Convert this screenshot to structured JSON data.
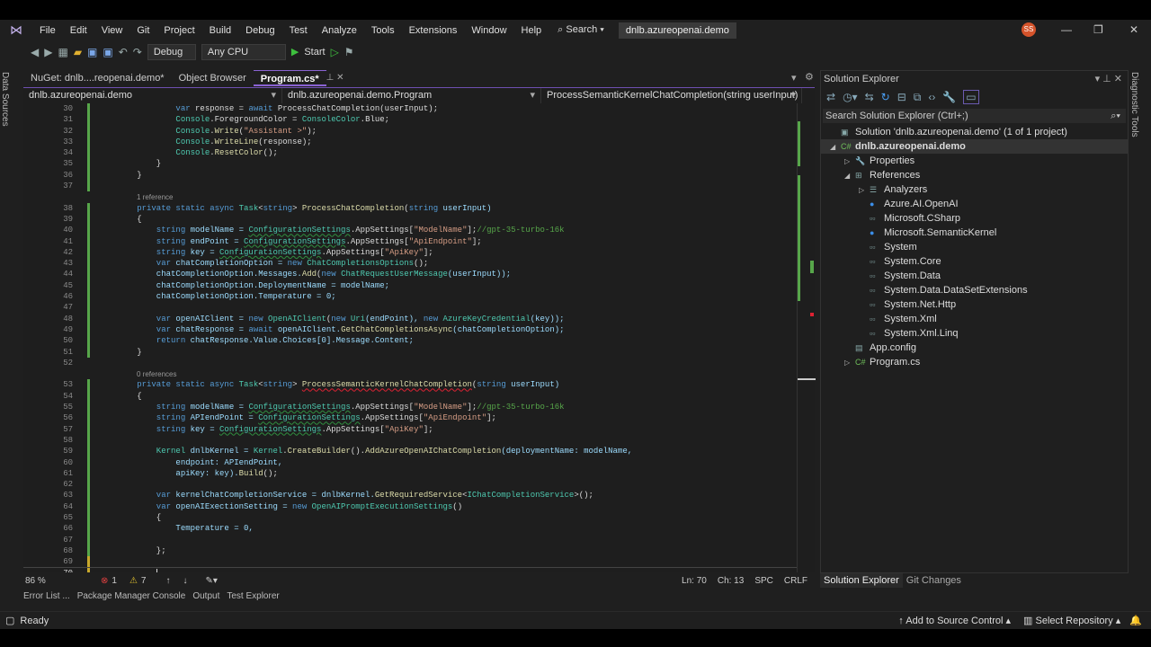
{
  "menu": [
    "File",
    "Edit",
    "View",
    "Git",
    "Project",
    "Build",
    "Debug",
    "Test",
    "Analyze",
    "Tools",
    "Extensions",
    "Window",
    "Help"
  ],
  "search_label": "Search",
  "window_title": "dnlb.azureopenai.demo",
  "avatar": "SS",
  "toolbar": {
    "config": "Debug",
    "platform": "Any CPU",
    "start": "Start"
  },
  "left_strip": "Data Sources",
  "right_strip": "Diagnostic Tools",
  "tabs": [
    {
      "label": "NuGet: dnlb....reopenai.demo*"
    },
    {
      "label": "Object Browser"
    },
    {
      "label": "Program.cs*"
    }
  ],
  "nav": {
    "project": "dnlb.azureopenai.demo",
    "type": "dnlb.azureopenai.demo.Program",
    "member": "ProcessSemanticKernelChatCompletion(string userInput)"
  },
  "code": [
    {
      "n": "30",
      "t": [
        [
          "                var ",
          "kw"
        ],
        [
          "response = ",
          "id"
        ],
        [
          "await ",
          "kw"
        ],
        [
          "ProcessChatCompletion(userInput);",
          "id"
        ]
      ]
    },
    {
      "n": "31",
      "t": [
        [
          "                Console",
          "ty"
        ],
        [
          ".ForegroundColor = ",
          "id"
        ],
        [
          "ConsoleColor",
          "ty"
        ],
        [
          ".Blue;",
          "id"
        ]
      ]
    },
    {
      "n": "32",
      "t": [
        [
          "                Console",
          "ty"
        ],
        [
          ".",
          "id"
        ],
        [
          "Write",
          "mt"
        ],
        [
          "(",
          "id"
        ],
        [
          "\"Assistant >\"",
          "st"
        ],
        [
          ");",
          "id"
        ]
      ]
    },
    {
      "n": "33",
      "t": [
        [
          "                Console",
          "ty"
        ],
        [
          ".",
          "id"
        ],
        [
          "WriteLine",
          "mt"
        ],
        [
          "(response);",
          "id"
        ]
      ]
    },
    {
      "n": "34",
      "t": [
        [
          "                Console",
          "ty"
        ],
        [
          ".",
          "id"
        ],
        [
          "ResetColor",
          "mt"
        ],
        [
          "();",
          "id"
        ]
      ]
    },
    {
      "n": "35",
      "t": [
        [
          "            }",
          "id"
        ]
      ]
    },
    {
      "n": "36",
      "t": [
        [
          "        }",
          "id"
        ]
      ]
    },
    {
      "n": "37",
      "t": []
    },
    {
      "n": "38",
      "lens": "1 reference",
      "t": [
        [
          "        private static async ",
          "kw"
        ],
        [
          "Task",
          "ty"
        ],
        [
          "<",
          "id"
        ],
        [
          "string",
          "kw"
        ],
        [
          "> ",
          "id"
        ],
        [
          "ProcessChatCompletion",
          "mt"
        ],
        [
          "(",
          "id"
        ],
        [
          "string ",
          "kw"
        ],
        [
          "userInput)",
          "vr"
        ]
      ]
    },
    {
      "n": "39",
      "t": [
        [
          "        {",
          "id"
        ]
      ]
    },
    {
      "n": "40",
      "t": [
        [
          "            string ",
          "kw"
        ],
        [
          "modelName = ",
          "vr"
        ],
        [
          "ConfigurationSettings",
          "ty sq"
        ],
        [
          ".AppSettings[",
          "id"
        ],
        [
          "\"ModelName\"",
          "st"
        ],
        [
          "];",
          "id"
        ],
        [
          "//gpt-35-turbo-16k",
          "cm"
        ]
      ]
    },
    {
      "n": "41",
      "t": [
        [
          "            string ",
          "kw"
        ],
        [
          "endPoint = ",
          "vr"
        ],
        [
          "ConfigurationSettings",
          "ty sq"
        ],
        [
          ".AppSettings[",
          "id"
        ],
        [
          "\"ApiEndpoint\"",
          "st"
        ],
        [
          "];",
          "id"
        ]
      ]
    },
    {
      "n": "42",
      "t": [
        [
          "            string ",
          "kw"
        ],
        [
          "key = ",
          "vr"
        ],
        [
          "ConfigurationSettings",
          "ty sq"
        ],
        [
          ".AppSettings[",
          "id"
        ],
        [
          "\"ApiKey\"",
          "st"
        ],
        [
          "];",
          "id"
        ]
      ]
    },
    {
      "n": "43",
      "t": [
        [
          "            var ",
          "kw"
        ],
        [
          "chatCompletionOption = ",
          "vr"
        ],
        [
          "new ",
          "kw"
        ],
        [
          "ChatCompletionsOptions",
          "ty"
        ],
        [
          "();",
          "id"
        ]
      ]
    },
    {
      "n": "44",
      "t": [
        [
          "            chatCompletionOption.Messages.",
          "vr"
        ],
        [
          "Add",
          "mt"
        ],
        [
          "(",
          "id"
        ],
        [
          "new ",
          "kw"
        ],
        [
          "ChatRequestUserMessage",
          "ty"
        ],
        [
          "(userInput));",
          "vr"
        ]
      ]
    },
    {
      "n": "45",
      "t": [
        [
          "            chatCompletionOption.DeploymentName = modelName;",
          "vr"
        ]
      ]
    },
    {
      "n": "46",
      "t": [
        [
          "            chatCompletionOption.Temperature = 0;",
          "vr"
        ]
      ]
    },
    {
      "n": "47",
      "t": []
    },
    {
      "n": "48",
      "t": [
        [
          "            var ",
          "kw"
        ],
        [
          "openAIClient = ",
          "vr"
        ],
        [
          "new ",
          "kw"
        ],
        [
          "OpenAIClient",
          "ty"
        ],
        [
          "(",
          "id"
        ],
        [
          "new ",
          "kw"
        ],
        [
          "Uri",
          "ty"
        ],
        [
          "(endPoint), ",
          "vr"
        ],
        [
          "new ",
          "kw"
        ],
        [
          "AzureKeyCredential",
          "ty"
        ],
        [
          "(key));",
          "vr"
        ]
      ]
    },
    {
      "n": "49",
      "t": [
        [
          "            var ",
          "kw"
        ],
        [
          "chatResponse = ",
          "vr"
        ],
        [
          "await ",
          "kw"
        ],
        [
          "openAIClient.",
          "vr"
        ],
        [
          "GetChatCompletionsAsync",
          "mt"
        ],
        [
          "(chatCompletionOption);",
          "vr"
        ]
      ]
    },
    {
      "n": "50",
      "t": [
        [
          "            return ",
          "kw"
        ],
        [
          "chatResponse.Value.Choices[0].Message.Content;",
          "vr"
        ]
      ]
    },
    {
      "n": "51",
      "t": [
        [
          "        }",
          "id"
        ]
      ]
    },
    {
      "n": "52",
      "t": []
    },
    {
      "n": "53",
      "lens": "0 references",
      "t": [
        [
          "        private static async ",
          "kw"
        ],
        [
          "Task",
          "ty"
        ],
        [
          "<",
          "id"
        ],
        [
          "string",
          "kw"
        ],
        [
          "> ",
          "id"
        ],
        [
          "ProcessSemanticKernelChatCompletion",
          "mt er"
        ],
        [
          "(",
          "id"
        ],
        [
          "string ",
          "kw"
        ],
        [
          "userInput)",
          "vr"
        ]
      ]
    },
    {
      "n": "54",
      "t": [
        [
          "        {",
          "id"
        ]
      ]
    },
    {
      "n": "55",
      "t": [
        [
          "            string ",
          "kw"
        ],
        [
          "modelName = ",
          "vr"
        ],
        [
          "ConfigurationSettings",
          "ty sq"
        ],
        [
          ".AppSettings[",
          "id"
        ],
        [
          "\"ModelName\"",
          "st"
        ],
        [
          "];",
          "id"
        ],
        [
          "//gpt-35-turbo-16k",
          "cm"
        ]
      ]
    },
    {
      "n": "56",
      "t": [
        [
          "            string ",
          "kw"
        ],
        [
          "APIendPoint = ",
          "vr"
        ],
        [
          "ConfigurationSettings",
          "ty sq"
        ],
        [
          ".AppSettings[",
          "id"
        ],
        [
          "\"ApiEndpoint\"",
          "st"
        ],
        [
          "];",
          "id"
        ]
      ]
    },
    {
      "n": "57",
      "t": [
        [
          "            string ",
          "kw"
        ],
        [
          "key = ",
          "vr"
        ],
        [
          "ConfigurationSettings",
          "ty sq"
        ],
        [
          ".AppSettings[",
          "id"
        ],
        [
          "\"ApiKey\"",
          "st"
        ],
        [
          "];",
          "id"
        ]
      ]
    },
    {
      "n": "58",
      "t": []
    },
    {
      "n": "59",
      "t": [
        [
          "            Kernel ",
          "ty"
        ],
        [
          "dnlbKernel = ",
          "vr"
        ],
        [
          "Kernel",
          "ty"
        ],
        [
          ".",
          "id"
        ],
        [
          "CreateBuilder",
          "mt"
        ],
        [
          "().",
          "id"
        ],
        [
          "AddAzureOpenAIChatCompletion",
          "mt"
        ],
        [
          "(deploymentName: modelName,",
          "vr"
        ]
      ]
    },
    {
      "n": "60",
      "t": [
        [
          "                endpoint: APIendPoint,",
          "vr"
        ]
      ]
    },
    {
      "n": "61",
      "t": [
        [
          "                apiKey: key).",
          "vr"
        ],
        [
          "Build",
          "mt"
        ],
        [
          "();",
          "id"
        ]
      ]
    },
    {
      "n": "62",
      "t": []
    },
    {
      "n": "63",
      "t": [
        [
          "            var ",
          "kw"
        ],
        [
          "kernelChatCompletionService = dnlbKernel.",
          "vr"
        ],
        [
          "GetRequiredService",
          "mt"
        ],
        [
          "<",
          "id"
        ],
        [
          "IChatCompletionService",
          "ty"
        ],
        [
          ">();",
          "id"
        ]
      ]
    },
    {
      "n": "64",
      "t": [
        [
          "            var ",
          "kw"
        ],
        [
          "openAIExectionSetting = ",
          "vr"
        ],
        [
          "new ",
          "kw"
        ],
        [
          "OpenAIPromptExecutionSettings",
          "ty"
        ],
        [
          "()",
          "id"
        ]
      ]
    },
    {
      "n": "65",
      "t": [
        [
          "            {",
          "id"
        ]
      ]
    },
    {
      "n": "66",
      "t": [
        [
          "                Temperature = 0,",
          "vr"
        ]
      ]
    },
    {
      "n": "67",
      "t": []
    },
    {
      "n": "68",
      "t": [
        [
          "            };",
          "id"
        ]
      ]
    },
    {
      "n": "69",
      "t": []
    },
    {
      "n": "70",
      "cur": true,
      "t": [
        [
          "            ",
          "id"
        ]
      ]
    }
  ],
  "editor_status": {
    "zoom": "86 %",
    "errors": "1",
    "warnings": "7",
    "ln": "Ln: 70",
    "ch": "Ch: 13",
    "spc": "SPC",
    "crlf": "CRLF"
  },
  "bottom_tabs": [
    "Error List ...",
    "Package Manager Console",
    "Output",
    "Test Explorer"
  ],
  "status": {
    "ready": "Ready",
    "source_control": "Add to Source Control",
    "repo": "Select Repository"
  },
  "solution_explorer": {
    "title": "Solution Explorer",
    "search_placeholder": "Search Solution Explorer (Ctrl+;)",
    "items": [
      {
        "label": "Solution 'dnlb.azureopenai.demo' (1 of 1 project)",
        "depth": 0,
        "icon": "solution-icon",
        "glyph": "▣",
        "ex": ""
      },
      {
        "label": "dnlb.azureopenai.demo",
        "depth": 0,
        "icon": "csharp-project-icon",
        "glyph": "C#",
        "ex": "◢",
        "sel": true
      },
      {
        "label": "Properties",
        "depth": 1,
        "icon": "wrench-icon",
        "glyph": "🔧",
        "ex": "▷"
      },
      {
        "label": "References",
        "depth": 1,
        "icon": "references-icon",
        "glyph": "⊞",
        "ex": "◢"
      },
      {
        "label": "Analyzers",
        "depth": 2,
        "icon": "analyzers-icon",
        "glyph": "☰",
        "ex": "▷"
      },
      {
        "label": "Azure.AI.OpenAI",
        "depth": 2,
        "icon": "package-icon",
        "glyph": "●",
        "ex": ""
      },
      {
        "label": "Microsoft.CSharp",
        "depth": 2,
        "icon": "assembly-icon",
        "glyph": "▫▫",
        "ex": ""
      },
      {
        "label": "Microsoft.SemanticKernel",
        "depth": 2,
        "icon": "package-icon",
        "glyph": "●",
        "ex": ""
      },
      {
        "label": "System",
        "depth": 2,
        "icon": "assembly-icon",
        "glyph": "▫▫",
        "ex": ""
      },
      {
        "label": "System.Core",
        "depth": 2,
        "icon": "assembly-icon",
        "glyph": "▫▫",
        "ex": ""
      },
      {
        "label": "System.Data",
        "depth": 2,
        "icon": "assembly-icon",
        "glyph": "▫▫",
        "ex": ""
      },
      {
        "label": "System.Data.DataSetExtensions",
        "depth": 2,
        "icon": "assembly-icon",
        "glyph": "▫▫",
        "ex": ""
      },
      {
        "label": "System.Net.Http",
        "depth": 2,
        "icon": "assembly-icon",
        "glyph": "▫▫",
        "ex": ""
      },
      {
        "label": "System.Xml",
        "depth": 2,
        "icon": "assembly-icon",
        "glyph": "▫▫",
        "ex": ""
      },
      {
        "label": "System.Xml.Linq",
        "depth": 2,
        "icon": "assembly-icon",
        "glyph": "▫▫",
        "ex": ""
      },
      {
        "label": "App.config",
        "depth": 1,
        "icon": "config-file-icon",
        "glyph": "▤",
        "ex": ""
      },
      {
        "label": "Program.cs",
        "depth": 1,
        "icon": "csharp-file-icon",
        "glyph": "C#",
        "ex": "▷"
      }
    ],
    "tabs": [
      "Solution Explorer",
      "Git Changes"
    ]
  }
}
